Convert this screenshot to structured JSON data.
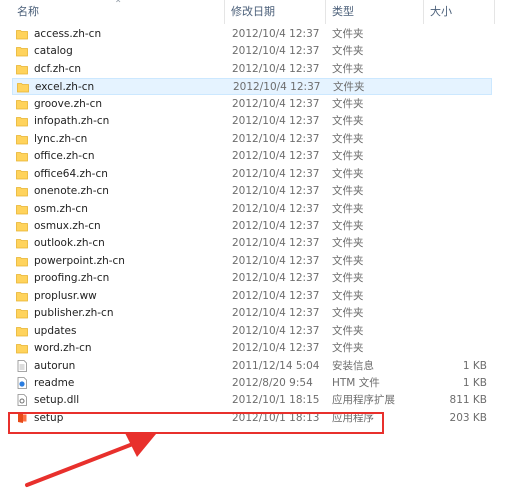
{
  "columns": {
    "name": "名称",
    "date": "修改日期",
    "type": "类型",
    "size": "大小"
  },
  "colors": {
    "folder": "#ffd35c",
    "folder_tab": "#e8b430",
    "highlight": "#e8302c",
    "hover_bg": "#e5f3ff"
  },
  "files": [
    {
      "name": "access.zh-cn",
      "date": "2012/10/4 12:37",
      "type": "文件夹",
      "size": "",
      "icon": "folder-icon"
    },
    {
      "name": "catalog",
      "date": "2012/10/4 12:37",
      "type": "文件夹",
      "size": "",
      "icon": "folder-icon"
    },
    {
      "name": "dcf.zh-cn",
      "date": "2012/10/4 12:37",
      "type": "文件夹",
      "size": "",
      "icon": "folder-icon"
    },
    {
      "name": "excel.zh-cn",
      "date": "2012/10/4 12:37",
      "type": "文件夹",
      "size": "",
      "icon": "folder-icon",
      "hover": true
    },
    {
      "name": "groove.zh-cn",
      "date": "2012/10/4 12:37",
      "type": "文件夹",
      "size": "",
      "icon": "folder-icon"
    },
    {
      "name": "infopath.zh-cn",
      "date": "2012/10/4 12:37",
      "type": "文件夹",
      "size": "",
      "icon": "folder-icon"
    },
    {
      "name": "lync.zh-cn",
      "date": "2012/10/4 12:37",
      "type": "文件夹",
      "size": "",
      "icon": "folder-icon"
    },
    {
      "name": "office.zh-cn",
      "date": "2012/10/4 12:37",
      "type": "文件夹",
      "size": "",
      "icon": "folder-icon"
    },
    {
      "name": "office64.zh-cn",
      "date": "2012/10/4 12:37",
      "type": "文件夹",
      "size": "",
      "icon": "folder-icon"
    },
    {
      "name": "onenote.zh-cn",
      "date": "2012/10/4 12:37",
      "type": "文件夹",
      "size": "",
      "icon": "folder-icon"
    },
    {
      "name": "osm.zh-cn",
      "date": "2012/10/4 12:37",
      "type": "文件夹",
      "size": "",
      "icon": "folder-icon"
    },
    {
      "name": "osmux.zh-cn",
      "date": "2012/10/4 12:37",
      "type": "文件夹",
      "size": "",
      "icon": "folder-icon"
    },
    {
      "name": "outlook.zh-cn",
      "date": "2012/10/4 12:37",
      "type": "文件夹",
      "size": "",
      "icon": "folder-icon"
    },
    {
      "name": "powerpoint.zh-cn",
      "date": "2012/10/4 12:37",
      "type": "文件夹",
      "size": "",
      "icon": "folder-icon"
    },
    {
      "name": "proofing.zh-cn",
      "date": "2012/10/4 12:37",
      "type": "文件夹",
      "size": "",
      "icon": "folder-icon"
    },
    {
      "name": "proplusr.ww",
      "date": "2012/10/4 12:37",
      "type": "文件夹",
      "size": "",
      "icon": "folder-icon"
    },
    {
      "name": "publisher.zh-cn",
      "date": "2012/10/4 12:37",
      "type": "文件夹",
      "size": "",
      "icon": "folder-icon"
    },
    {
      "name": "updates",
      "date": "2012/10/4 12:37",
      "type": "文件夹",
      "size": "",
      "icon": "folder-icon"
    },
    {
      "name": "word.zh-cn",
      "date": "2012/10/4 12:37",
      "type": "文件夹",
      "size": "",
      "icon": "folder-icon"
    },
    {
      "name": "autorun",
      "date": "2011/12/14 5:04",
      "type": "安装信息",
      "size": "1 KB",
      "icon": "setup-info-icon"
    },
    {
      "name": "readme",
      "date": "2012/8/20 9:54",
      "type": "HTM 文件",
      "size": "1 KB",
      "icon": "htm-file-icon"
    },
    {
      "name": "setup.dll",
      "date": "2012/10/1 18:15",
      "type": "应用程序扩展",
      "size": "811 KB",
      "icon": "dll-file-icon"
    },
    {
      "name": "setup",
      "date": "2012/10/1 18:13",
      "type": "应用程序",
      "size": "203 KB",
      "icon": "office-setup-icon"
    }
  ]
}
